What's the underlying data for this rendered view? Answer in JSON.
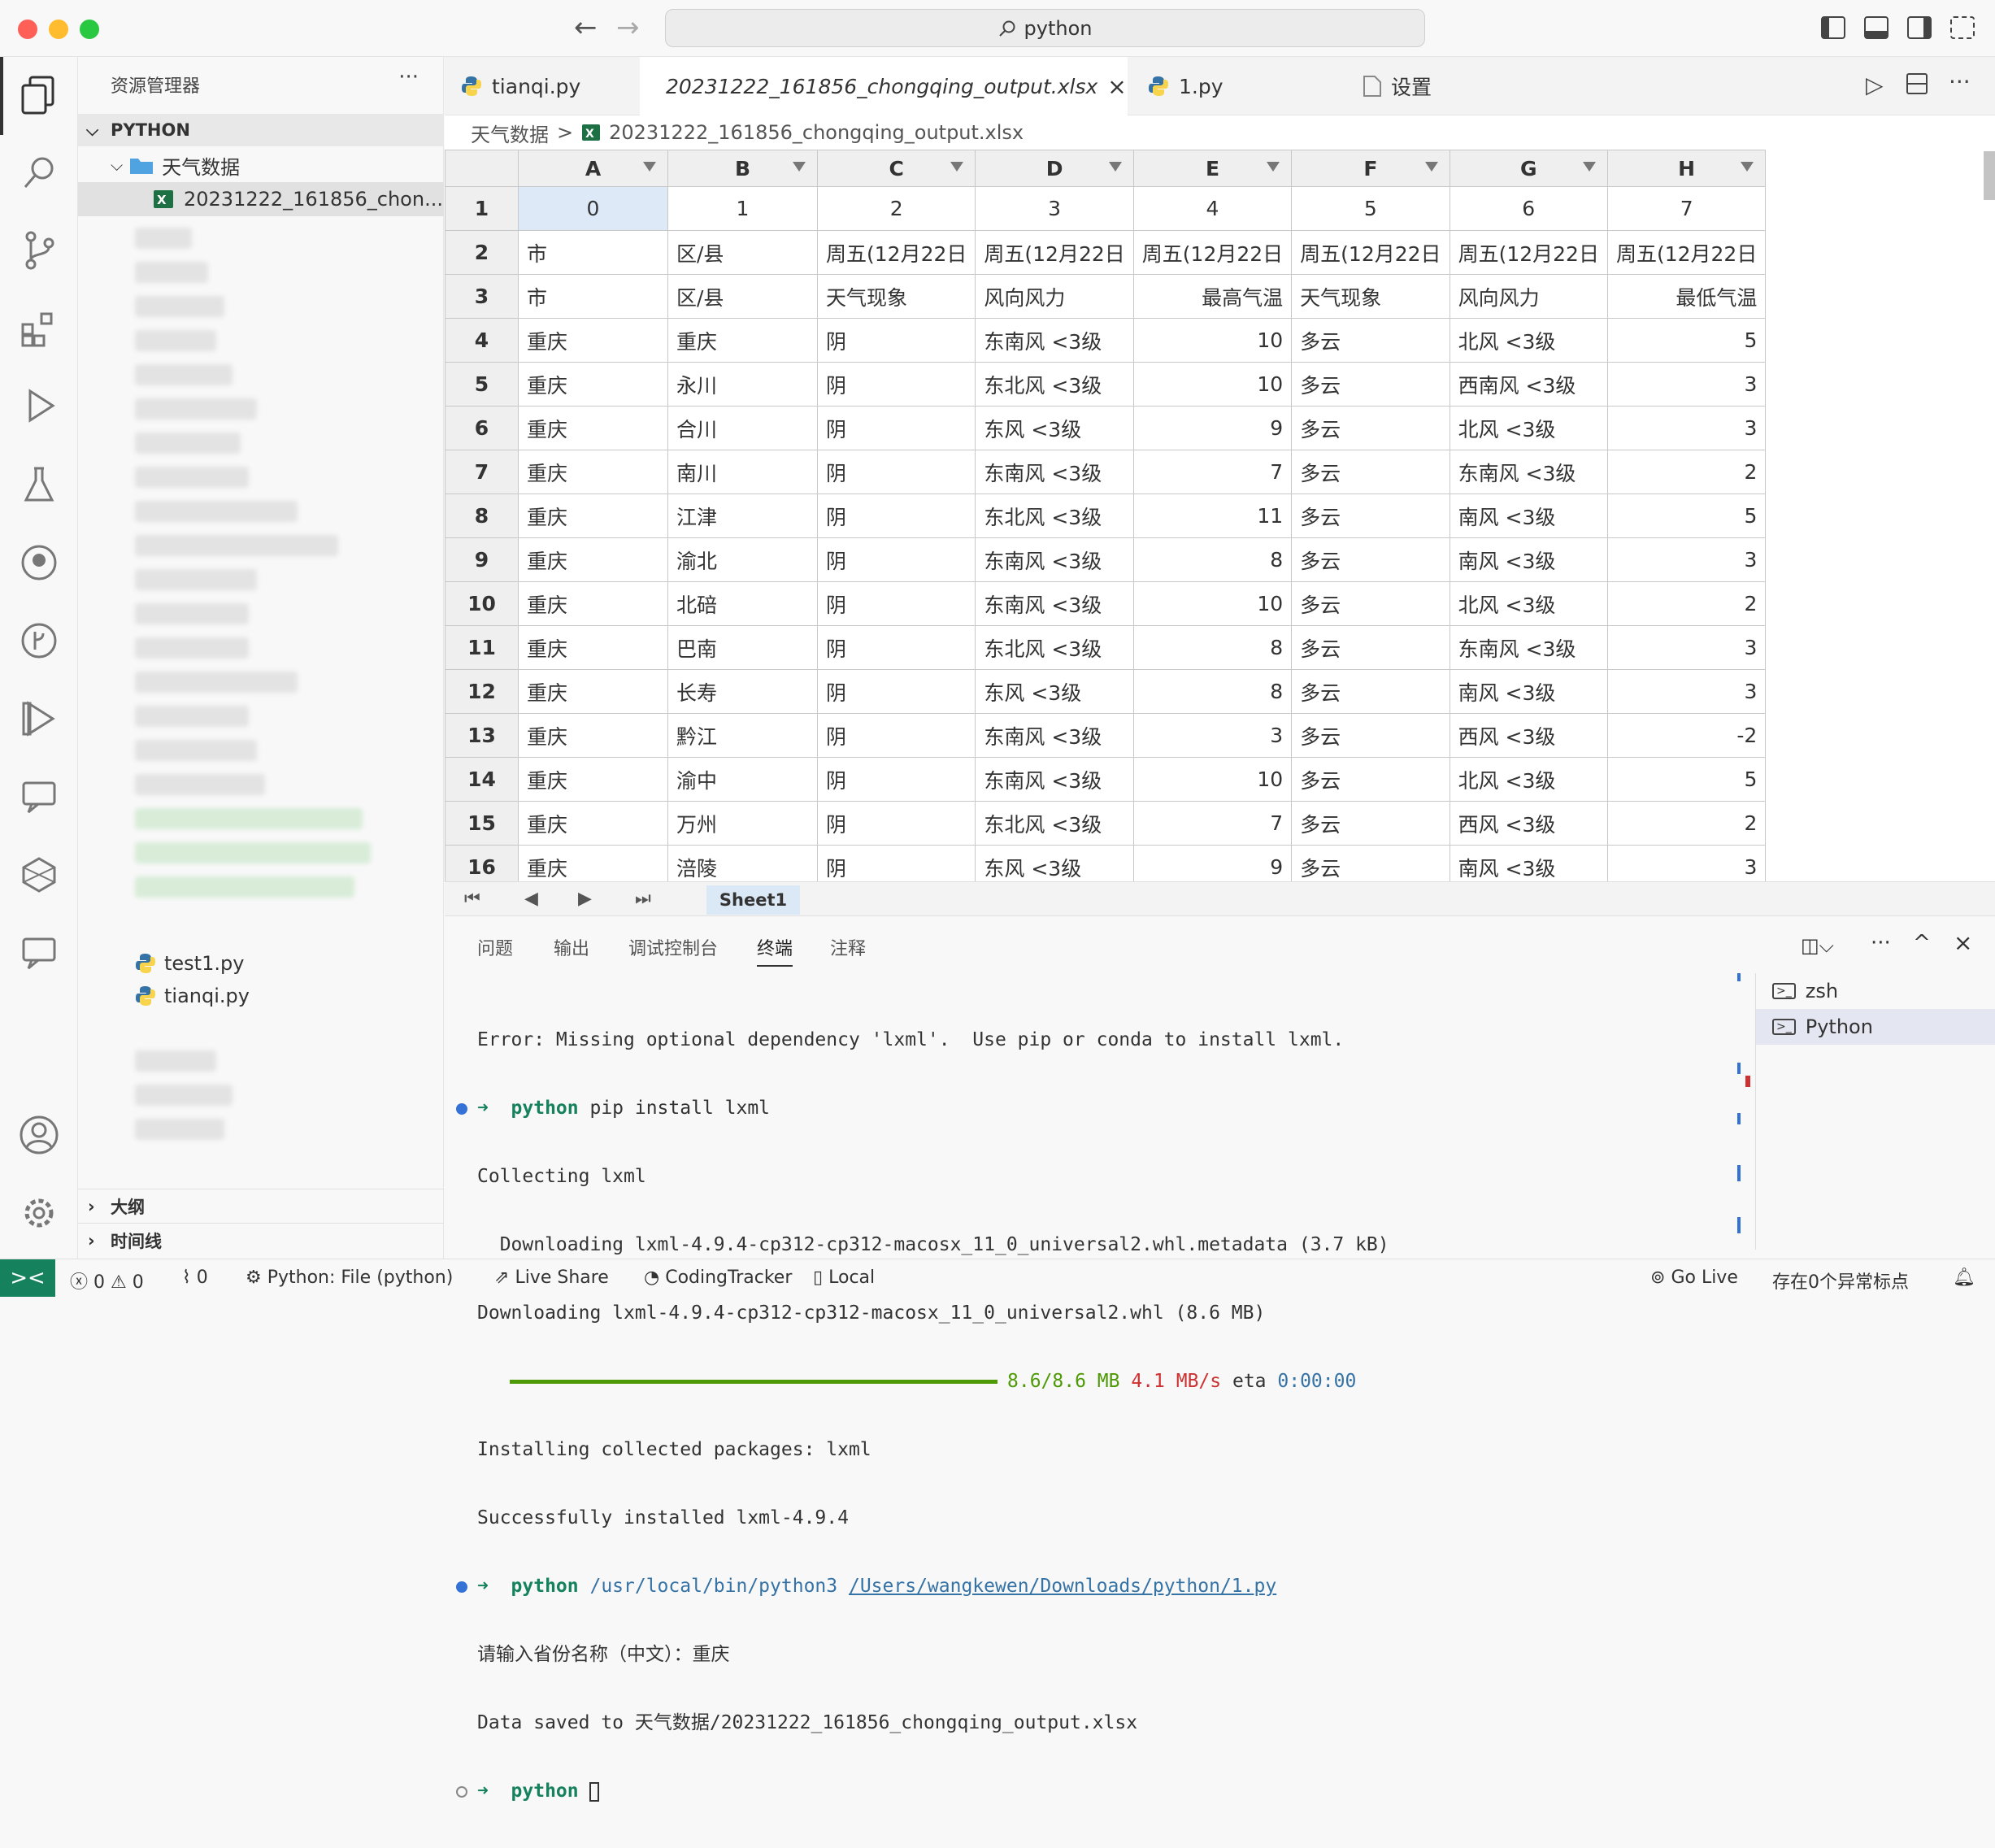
{
  "titlebar": {
    "search": "python"
  },
  "sidebar": {
    "title": "资源管理器",
    "more": "···",
    "root": "PYTHON",
    "folder": "天气数据",
    "file_selected": "20231222_161856_chon...",
    "file_tianqi": "tianqi.py",
    "file_test": "test1.py",
    "outline": "大纲",
    "timeline": "时间线"
  },
  "tabs": [
    {
      "label": "tianqi.py",
      "icon": "python-icon"
    },
    {
      "label": "20231222_161856_chongqing_output.xlsx",
      "icon": "excel-icon",
      "close": "×"
    },
    {
      "label": "1.py",
      "icon": "python-icon"
    },
    {
      "label": "设置",
      "icon": "settings-file-icon"
    }
  ],
  "breadcrumb": {
    "folder": "天气数据",
    "sep": ">",
    "file": "20231222_161856_chongqing_output.xlsx"
  },
  "sheet": {
    "columns": [
      "A",
      "B",
      "C",
      "D",
      "E",
      "F",
      "G",
      "H"
    ],
    "rows": [
      [
        "1",
        "0",
        "1",
        "2",
        "3",
        "4",
        "5",
        "6",
        "7"
      ],
      [
        "2",
        "市",
        "区/县",
        "周五(12月22日",
        "周五(12月22日",
        "周五(12月22日",
        "周五(12月22日",
        "周五(12月22日",
        "周五(12月22日"
      ],
      [
        "3",
        "市",
        "区/县",
        "天气现象",
        "风向风力",
        "最高气温",
        "天气现象",
        "风向风力",
        "最低气温"
      ],
      [
        "4",
        "重庆",
        "重庆",
        "阴",
        "东南风 <3级",
        "10",
        "多云",
        "北风 <3级",
        "5"
      ],
      [
        "5",
        "重庆",
        "永川",
        "阴",
        "东北风 <3级",
        "10",
        "多云",
        "西南风 <3级",
        "3"
      ],
      [
        "6",
        "重庆",
        "合川",
        "阴",
        "东风 <3级",
        "9",
        "多云",
        "北风 <3级",
        "3"
      ],
      [
        "7",
        "重庆",
        "南川",
        "阴",
        "东南风 <3级",
        "7",
        "多云",
        "东南风 <3级",
        "2"
      ],
      [
        "8",
        "重庆",
        "江津",
        "阴",
        "东北风 <3级",
        "11",
        "多云",
        "南风 <3级",
        "5"
      ],
      [
        "9",
        "重庆",
        "渝北",
        "阴",
        "东南风 <3级",
        "8",
        "多云",
        "南风 <3级",
        "3"
      ],
      [
        "10",
        "重庆",
        "北碚",
        "阴",
        "东南风 <3级",
        "10",
        "多云",
        "北风 <3级",
        "2"
      ],
      [
        "11",
        "重庆",
        "巴南",
        "阴",
        "东北风 <3级",
        "8",
        "多云",
        "东南风 <3级",
        "3"
      ],
      [
        "12",
        "重庆",
        "长寿",
        "阴",
        "东风 <3级",
        "8",
        "多云",
        "南风 <3级",
        "3"
      ],
      [
        "13",
        "重庆",
        "黔江",
        "阴",
        "东南风 <3级",
        "3",
        "多云",
        "西风 <3级",
        "-2"
      ],
      [
        "14",
        "重庆",
        "渝中",
        "阴",
        "东南风 <3级",
        "10",
        "多云",
        "北风 <3级",
        "5"
      ],
      [
        "15",
        "重庆",
        "万州",
        "阴",
        "东北风 <3级",
        "7",
        "多云",
        "西风 <3级",
        "2"
      ],
      [
        "16",
        "重庆",
        "涪陵",
        "阴",
        "东风 <3级",
        "9",
        "多云",
        "南风 <3级",
        "3"
      ]
    ],
    "sheet_tab": "Sheet1"
  },
  "panel": {
    "tabs": [
      "问题",
      "输出",
      "调试控制台",
      "终端",
      "注释"
    ],
    "active_tab": "终端",
    "terminals": [
      "zsh",
      "Python"
    ]
  },
  "terminal": {
    "l1": "Error: Missing optional dependency 'lxml'.  Use pip or conda to install lxml.",
    "l2_prompt": "➜  python",
    "l2_cmd": " pip install lxml",
    "l3": "Collecting lxml",
    "l4": "  Downloading lxml-4.9.4-cp312-cp312-macosx_11_0_universal2.whl.metadata (3.7 kB)",
    "l5": "Downloading lxml-4.9.4-cp312-cp312-macosx_11_0_universal2.whl (8.6 MB)",
    "l6_size": "8.6/8.6 MB",
    "l6_speed": "4.1 MB/s",
    "l6_eta_label": "eta",
    "l6_eta": "0:00:00",
    "download_progress": 1.0,
    "l7": "Installing collected packages: lxml",
    "l8": "Successfully installed lxml-4.9.4",
    "l9_prompt": "➜  python",
    "l9_cmd": " /usr/local/bin/python3",
    "l9_path": "/Users/wangkewen/Downloads/python/1.py",
    "l10": "请输入省份名称（中文）：重庆",
    "l11": "Data saved to 天气数据/20231222_161856_chongqing_output.xlsx",
    "l12_prompt": "➜  python"
  },
  "statusbar": {
    "errors": "0",
    "warnings": "0",
    "ports": "0",
    "interpreter": "Python: File (python)",
    "liveshare": "Live Share",
    "tracker": "CodingTracker",
    "local": "Local",
    "golive": "Go Live",
    "anomaly": "存在0个异常标点"
  },
  "colors": {
    "accent": "#16825d",
    "excel": "#1d7044",
    "python_blue": "#3572a5",
    "python_yellow": "#f7d44c",
    "error": "#cd3131",
    "progress": "#4e9a06"
  }
}
